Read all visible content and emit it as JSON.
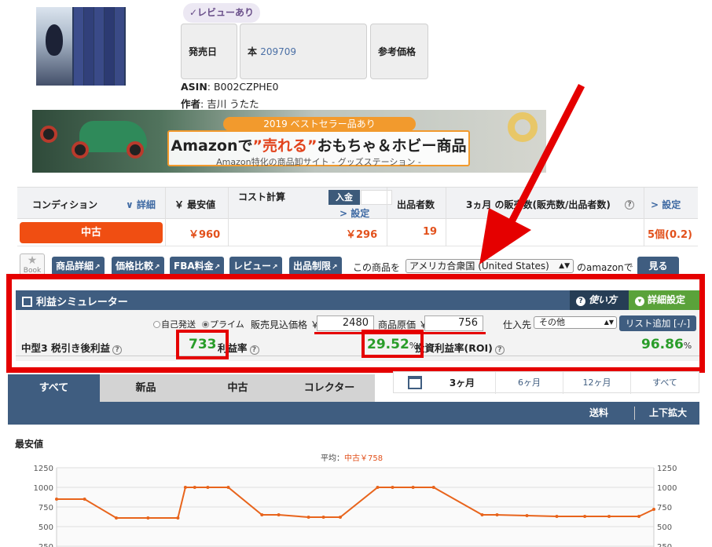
{
  "product": {
    "review_badge": "✓レビューあり",
    "info_boxes": [
      {
        "label": "発売日",
        "value": ""
      },
      {
        "label": "本",
        "value": "209709"
      },
      {
        "label": "参考価格",
        "value": ""
      }
    ],
    "asin_label": "ASIN",
    "asin": ": B002CZPHE0",
    "author_label": "作者",
    "author": ": 吉川 うたた"
  },
  "banner": {
    "ribbon": "2019 ベストセラー品あり",
    "title_pre": "Amazonで",
    "title_hl": "”売れる”",
    "title_post": "おもちゃ＆ホビー商品",
    "subtitle": "Amazon特化の商品卸サイト - グッズステーション -"
  },
  "condition_table": {
    "headers": {
      "condition": "コンディション",
      "detail": "∨ 詳細",
      "lowest": "￥ 最安値",
      "cost": "コスト計算",
      "nyukin": "入金",
      "settings": "> 設定",
      "sellers": "出品者数",
      "sales": "3ヵ月 の販売数(販売数/出品者数)",
      "settings2": "> 設定"
    },
    "row": {
      "condition": "中古",
      "lowest": "￥960",
      "cost": "￥296",
      "sellers": "19",
      "sales": "5個(0.2)"
    }
  },
  "toolbar": {
    "book": "Book",
    "buttons": [
      "商品詳細",
      "価格比較",
      "FBA料金",
      "レビュー",
      "出品制限"
    ],
    "country_label": "この商品を",
    "country": "アメリカ合衆国 (United States)",
    "amazon_suffix": "のamazonで",
    "view": "見る"
  },
  "simulator": {
    "title": "利益シミュレーター",
    "howto": "使い方",
    "detail_settings": "詳細設定",
    "opt_self": "自己発送",
    "opt_prime": "プライム",
    "sale_price_label": "販売見込価格 ￥",
    "sale_price": "2480",
    "cost_label": "商品原価 ￥",
    "cost": "756",
    "supplier_label": "仕入先",
    "supplier": "その他",
    "add_list": "リスト追加 [-/-]",
    "profit_label": "中型3 税引き後利益",
    "profit": "733",
    "margin_label": "利益率",
    "margin": "29.52",
    "roi_label": "投資利益率(ROI)",
    "roi": "96.86",
    "pct": "%"
  },
  "tabs": [
    "すべて",
    "新品",
    "中古",
    "コレクター"
  ],
  "periods": [
    "3ヶ月",
    "6ヶ月",
    "12ヶ月",
    "すべて"
  ],
  "toolbar2": {
    "shipping": "送料",
    "zoom": "上下拡大"
  },
  "chart_data": {
    "type": "line",
    "title": "最安値",
    "subtitle_pre": "平均：",
    "subtitle_hl": "中古￥758",
    "y_ticks": [
      1250,
      1000,
      750,
      500,
      250
    ],
    "ylim": [
      250,
      1250
    ],
    "grid": true,
    "series": [
      {
        "name": "中古",
        "color": "#e8641c",
        "x": [
          0,
          1.5,
          3.2,
          4.9,
          6.5,
          6.9,
          7.4,
          8.1,
          9.2,
          11,
          11.9,
          13.5,
          14.3,
          15.2,
          17.2,
          18,
          19.1,
          20.2,
          22.8,
          23.6,
          25.2,
          26.8,
          28.3,
          29.6,
          31.2,
          32
        ],
        "values": [
          850,
          850,
          610,
          610,
          610,
          1000,
          1000,
          1000,
          1000,
          650,
          650,
          620,
          620,
          620,
          1000,
          1000,
          1000,
          1000,
          650,
          650,
          640,
          630,
          630,
          630,
          630,
          720
        ]
      }
    ]
  }
}
